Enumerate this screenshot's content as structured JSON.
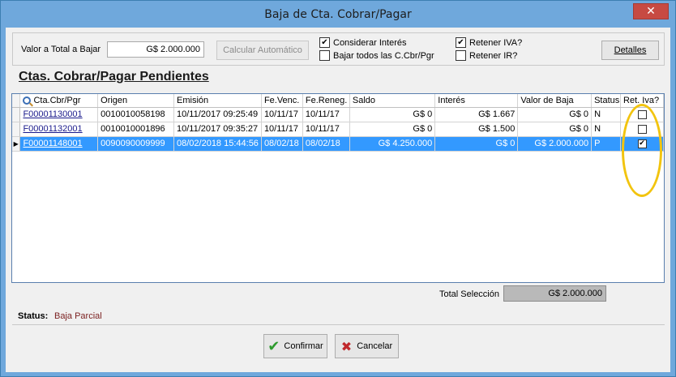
{
  "window": {
    "title": "Baja de Cta. Cobrar/Pagar",
    "close_glyph": "✕"
  },
  "form": {
    "valor_label": "Valor a Total a Bajar",
    "valor_value": "G$ 2.000.000",
    "calc_button": "Calcular Automático",
    "chk_interes_label": "Considerar Interés",
    "chk_interes_checked": true,
    "chk_bajar_label": "Bajar todos las C.Cbr/Pgr",
    "chk_bajar_checked": false,
    "chk_iva_label": "Retener IVA?",
    "chk_iva_checked": true,
    "chk_ir_label": "Retener IR?",
    "chk_ir_checked": false,
    "detalles_button": "Detalles"
  },
  "section_title": "Ctas. Cobrar/Pagar Pendientes",
  "grid": {
    "columns": [
      "Cta.Cbr/Pgr",
      "Origen",
      "Emisión",
      "Fe.Venc.",
      "Fe.Reneg.",
      "Saldo",
      "Interés",
      "Valor de Baja",
      "Status",
      "Ret. Iva?"
    ],
    "rows": [
      {
        "cta": "F00001130001",
        "origen": "0010010058198",
        "emision": "10/11/2017 09:25:49",
        "venc": "10/11/17",
        "reneg": "10/11/17",
        "saldo": "G$ 0",
        "interes": "G$ 1.667",
        "baja": "G$ 0",
        "status": "N",
        "ret_iva": false,
        "selected": false
      },
      {
        "cta": "F00001132001",
        "origen": "0010010001896",
        "emision": "10/11/2017 09:35:27",
        "venc": "10/11/17",
        "reneg": "10/11/17",
        "saldo": "G$ 0",
        "interes": "G$ 1.500",
        "baja": "G$ 0",
        "status": "N",
        "ret_iva": false,
        "selected": false
      },
      {
        "cta": "F00001148001",
        "origen": "0090090009999",
        "emision": "08/02/2018 15:44:56",
        "venc": "08/02/18",
        "reneg": "08/02/18",
        "saldo": "G$ 4.250.000",
        "interes": "G$ 0",
        "baja": "G$ 2.000.000",
        "status": "P",
        "ret_iva": true,
        "selected": true
      }
    ]
  },
  "total": {
    "label": "Total Selección",
    "value": "G$ 2.000.000"
  },
  "status": {
    "label": "Status:",
    "value": "Baja Parcial"
  },
  "buttons": {
    "confirm": "Confirmar",
    "cancel": "Cancelar"
  },
  "colors": {
    "selection": "#3399ff",
    "highlight": "#f2c40f",
    "titlebar": "#6fa8dc"
  },
  "icons": {
    "search": "search-icon",
    "confirm": "check-icon",
    "cancel": "x-icon",
    "row_pointer": "row-pointer-icon"
  }
}
